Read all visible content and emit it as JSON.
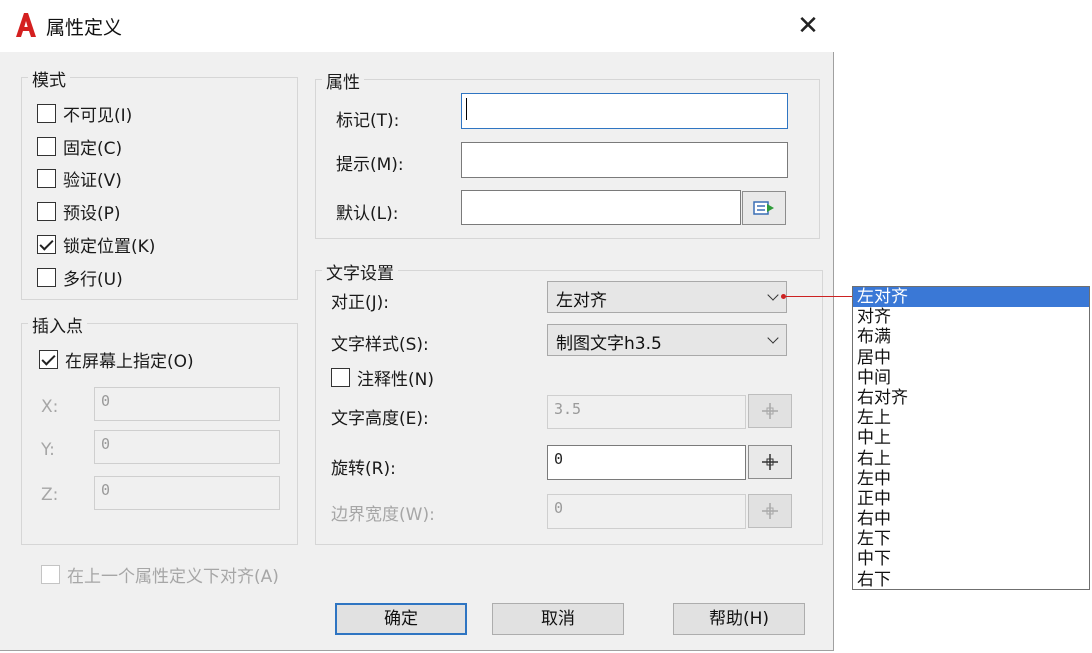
{
  "window": {
    "title": "属性定义",
    "close_label": "✕",
    "accent_color": "#2f75c2"
  },
  "mode_group": {
    "legend": "模式",
    "options": [
      {
        "label": "不可见(I)",
        "checked": false
      },
      {
        "label": "固定(C)",
        "checked": false
      },
      {
        "label": "验证(V)",
        "checked": false
      },
      {
        "label": "预设(P)",
        "checked": false
      },
      {
        "label": "锁定位置(K)",
        "checked": true
      },
      {
        "label": "多行(U)",
        "checked": false
      }
    ]
  },
  "insertion_group": {
    "legend": "插入点",
    "specify_on_screen": {
      "label": "在屏幕上指定(O)",
      "checked": true
    },
    "x": {
      "label": "X:",
      "value": "0"
    },
    "y": {
      "label": "Y:",
      "value": "0"
    },
    "z": {
      "label": "Z:",
      "value": "0"
    }
  },
  "attribute_group": {
    "legend": "属性",
    "tag": {
      "label": "标记(T):",
      "value": ""
    },
    "prompt": {
      "label": "提示(M):",
      "value": ""
    },
    "default": {
      "label": "默认(L):",
      "value": ""
    }
  },
  "text_group": {
    "legend": "文字设置",
    "justify": {
      "label": "对正(J):",
      "value": "左对齐"
    },
    "style": {
      "label": "文字样式(S):",
      "value": "制图文字h3.5"
    },
    "annotative": {
      "label": "注释性(N)",
      "checked": false
    },
    "height": {
      "label": "文字高度(E):",
      "value": "3.5"
    },
    "rotation": {
      "label": "旋转(R):",
      "value": "0"
    },
    "boundary_width": {
      "label": "边界宽度(W):",
      "value": "0"
    }
  },
  "align_below": {
    "label": "在上一个属性定义下对齐(A)",
    "checked": false
  },
  "buttons": {
    "ok": "确定",
    "cancel": "取消",
    "help": "帮助(H)"
  },
  "justify_dropdown": {
    "selected": "左对齐",
    "options": [
      "左对齐",
      "对齐",
      "布满",
      "居中",
      "中间",
      "右对齐",
      "左上",
      "中上",
      "右上",
      "左中",
      "正中",
      "右中",
      "左下",
      "中下",
      "右下"
    ]
  }
}
